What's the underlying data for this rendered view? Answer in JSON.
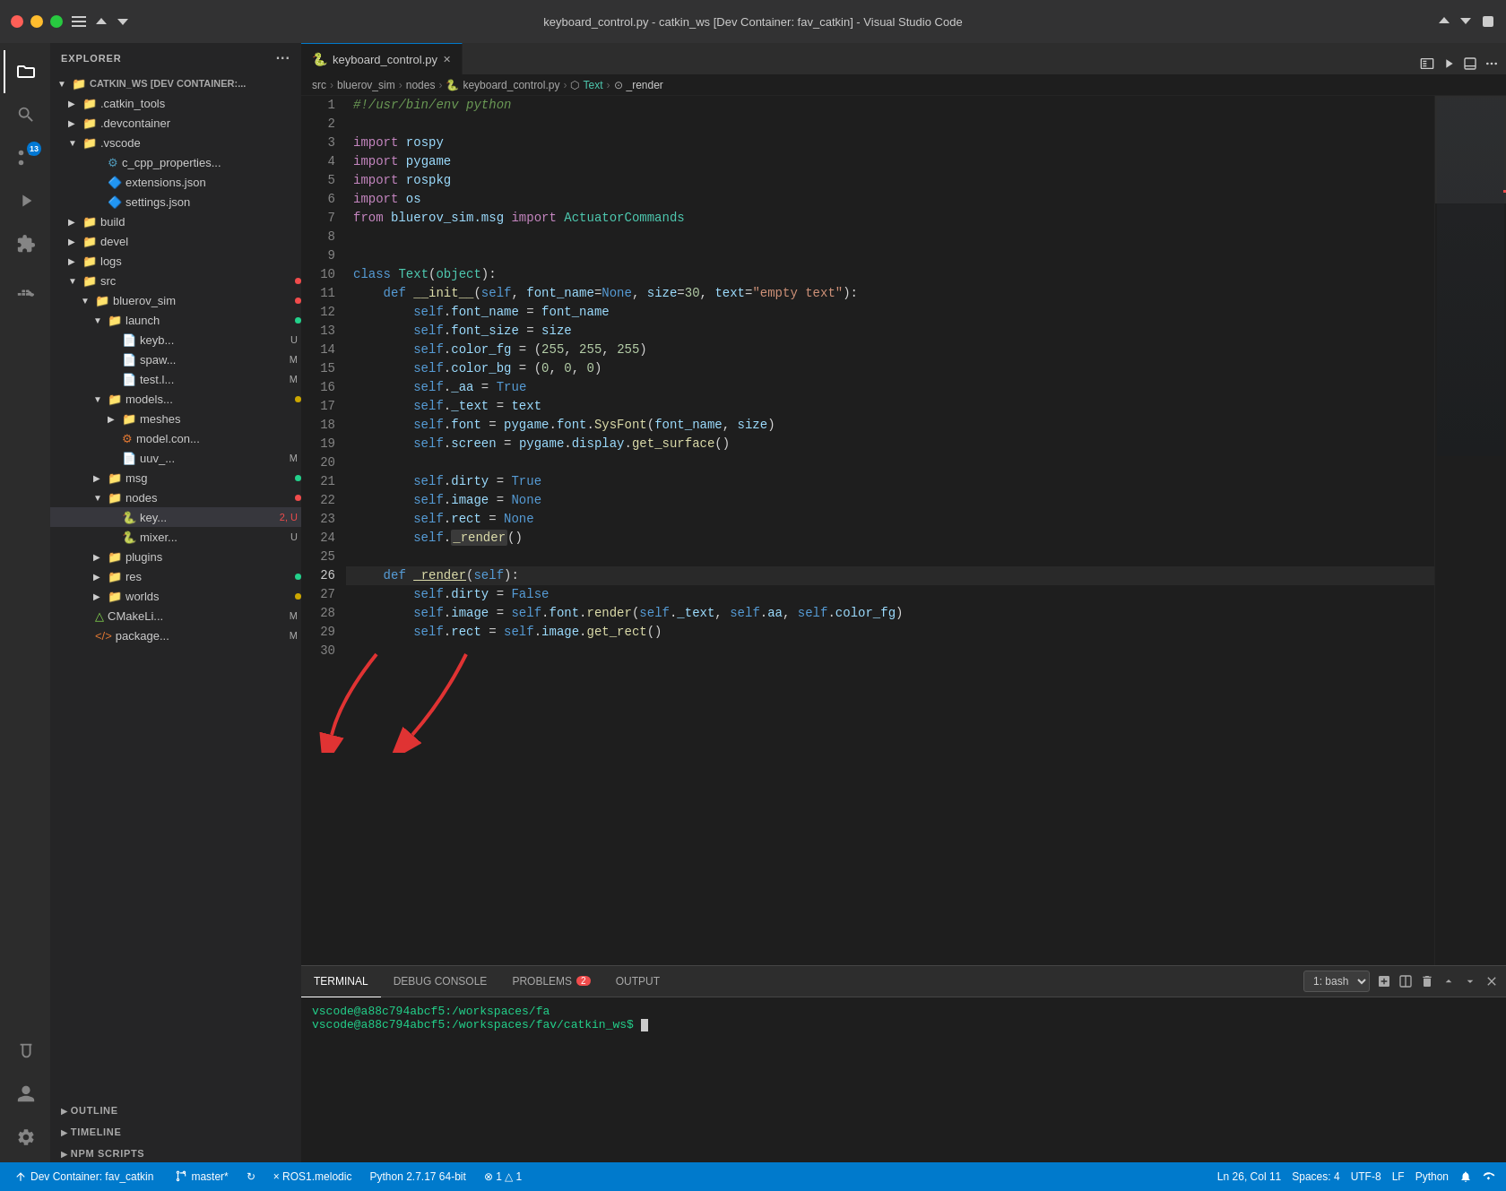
{
  "window": {
    "title": "keyboard_control.py - catkin_ws [Dev Container: fav_catkin] - Visual Studio Code"
  },
  "titleBar": {
    "close_label": "×",
    "min_label": "–",
    "max_label": "□"
  },
  "activityBar": {
    "icons": [
      {
        "name": "files-icon",
        "symbol": "⬜",
        "active": true,
        "badge": null
      },
      {
        "name": "search-icon",
        "symbol": "🔍",
        "active": false,
        "badge": null
      },
      {
        "name": "source-control-icon",
        "symbol": "⎇",
        "active": false,
        "badge": "13"
      },
      {
        "name": "run-icon",
        "symbol": "▷",
        "active": false,
        "badge": null
      },
      {
        "name": "extensions-icon",
        "symbol": "⊞",
        "active": false,
        "badge": null
      },
      {
        "name": "docker-icon",
        "symbol": "🐳",
        "active": false,
        "badge": null
      }
    ],
    "bottom": [
      {
        "name": "test-icon",
        "symbol": "🧪"
      },
      {
        "name": "account-icon",
        "symbol": "👤"
      },
      {
        "name": "settings-icon",
        "symbol": "⚙"
      }
    ]
  },
  "sidebar": {
    "title": "EXPLORER",
    "workspace": "CATKIN_WS [DEV CONTAINER:...",
    "tree": [
      {
        "level": 1,
        "label": ".catkin_tools",
        "type": "folder",
        "collapsed": true,
        "badge": null
      },
      {
        "level": 1,
        "label": ".devcontainer",
        "type": "folder",
        "collapsed": true,
        "badge": null
      },
      {
        "level": 1,
        "label": ".vscode",
        "type": "folder",
        "collapsed": false,
        "badge": null
      },
      {
        "level": 2,
        "label": "c_cpp_properties...",
        "type": "cpp",
        "badge": null
      },
      {
        "level": 2,
        "label": "extensions.json",
        "type": "json",
        "badge": null
      },
      {
        "level": 2,
        "label": "settings.json",
        "type": "json",
        "badge": null
      },
      {
        "level": 1,
        "label": "build",
        "type": "folder",
        "collapsed": true,
        "badge": null
      },
      {
        "level": 1,
        "label": "devel",
        "type": "folder",
        "collapsed": true,
        "badge": null
      },
      {
        "level": 1,
        "label": "logs",
        "type": "folder",
        "collapsed": true,
        "badge": null
      },
      {
        "level": 1,
        "label": "src",
        "type": "folder",
        "collapsed": false,
        "badge_color": "red"
      },
      {
        "level": 2,
        "label": "bluerov_sim",
        "type": "folder",
        "collapsed": false,
        "badge_color": "red"
      },
      {
        "level": 3,
        "label": "launch",
        "type": "folder",
        "collapsed": false,
        "badge_color": "green"
      },
      {
        "level": 4,
        "label": "keyb...",
        "type": "file",
        "badge": "U"
      },
      {
        "level": 4,
        "label": "spaw...",
        "type": "file",
        "badge": "M"
      },
      {
        "level": 4,
        "label": "test.l...",
        "type": "file",
        "badge": "M"
      },
      {
        "level": 3,
        "label": "models...",
        "type": "folder",
        "collapsed": false,
        "badge_color": "orange"
      },
      {
        "level": 4,
        "label": "meshes",
        "type": "folder",
        "collapsed": true,
        "badge": null
      },
      {
        "level": 4,
        "label": "model.con...",
        "type": "file",
        "badge": null
      },
      {
        "level": 4,
        "label": "uuv_...",
        "type": "file",
        "badge": "M"
      },
      {
        "level": 3,
        "label": "msg",
        "type": "folder",
        "collapsed": true,
        "badge_color": "green"
      },
      {
        "level": 3,
        "label": "nodes",
        "type": "folder",
        "collapsed": false,
        "badge_color": "red"
      },
      {
        "level": 4,
        "label": "key...",
        "type": "python",
        "badge": "2, U",
        "active": true
      },
      {
        "level": 4,
        "label": "mixer...",
        "type": "python",
        "badge": "U"
      },
      {
        "level": 3,
        "label": "plugins",
        "type": "folder",
        "collapsed": true,
        "badge": null
      },
      {
        "level": 3,
        "label": "res",
        "type": "folder",
        "collapsed": true,
        "badge_color": "green"
      },
      {
        "level": 3,
        "label": "worlds",
        "type": "folder",
        "collapsed": true,
        "badge_color": "orange"
      },
      {
        "level": 2,
        "label": "CMakeLi...",
        "type": "cmake",
        "badge": "M"
      },
      {
        "level": 2,
        "label": "package...",
        "type": "xml",
        "badge": "M"
      }
    ],
    "sections": [
      "OUTLINE",
      "TIMELINE",
      "NPM SCRIPTS"
    ]
  },
  "editor": {
    "tab": {
      "filename": "keyboard_control.py",
      "icon": "🐍",
      "modified": false
    },
    "breadcrumb": [
      "src",
      "bluerov_sim",
      "nodes",
      "keyboard_control.py",
      "Text",
      "_render"
    ],
    "lines": [
      {
        "n": 1,
        "code": "#!/usr/bin/env python",
        "type": "comment"
      },
      {
        "n": 2,
        "code": ""
      },
      {
        "n": 3,
        "code": "import rospy"
      },
      {
        "n": 4,
        "code": "import pygame"
      },
      {
        "n": 5,
        "code": "import rospkg"
      },
      {
        "n": 6,
        "code": "import os"
      },
      {
        "n": 7,
        "code": "from bluerov_sim.msg import ActuatorCommands"
      },
      {
        "n": 8,
        "code": ""
      },
      {
        "n": 9,
        "code": ""
      },
      {
        "n": 10,
        "code": "class Text(object):"
      },
      {
        "n": 11,
        "code": "    def __init__(self, font_name=None, size=30, text=\"empty text\"):"
      },
      {
        "n": 12,
        "code": "        self.font_name = font_name"
      },
      {
        "n": 13,
        "code": "        self.font_size = size"
      },
      {
        "n": 14,
        "code": "        self.color_fg = (255, 255, 255)"
      },
      {
        "n": 15,
        "code": "        self.color_bg = (0, 0, 0)"
      },
      {
        "n": 16,
        "code": "        self._aa = True"
      },
      {
        "n": 17,
        "code": "        self._text = text"
      },
      {
        "n": 18,
        "code": "        self.font = pygame.font.SysFont(font_name, size)"
      },
      {
        "n": 19,
        "code": "        self.screen = pygame.display.get_surface()"
      },
      {
        "n": 20,
        "code": ""
      },
      {
        "n": 21,
        "code": "        self.dirty = True"
      },
      {
        "n": 22,
        "code": "        self.image = None"
      },
      {
        "n": 23,
        "code": "        self.rect = None"
      },
      {
        "n": 24,
        "code": "        self._render()"
      },
      {
        "n": 25,
        "code": ""
      },
      {
        "n": 26,
        "code": "    def _render(self):"
      },
      {
        "n": 27,
        "code": "        self.dirty = False"
      },
      {
        "n": 28,
        "code": "        self.image = self.font.render(self._text, self.aa, self.color_fg)"
      },
      {
        "n": 29,
        "code": "        self.rect = self.image.get_rect()"
      },
      {
        "n": 30,
        "code": ""
      }
    ]
  },
  "terminal": {
    "tabs": [
      "TERMINAL",
      "DEBUG CONSOLE",
      "PROBLEMS",
      "OUTPUT"
    ],
    "problems_count": "2",
    "bash_label": "1: bash",
    "line1": "vscode@a88c794abcf5:/workspaces/fa",
    "line2": "vscode@a88c794abcf5:/workspaces/fav/catkin_ws$ "
  },
  "statusBar": {
    "dev_container": "Dev Container: fav_catkin",
    "branch": "master*",
    "sync": "↻",
    "ros": "× ROS1.melodic",
    "python": "Python 2.7.17 64-bit",
    "errors": "⊗ 1 △ 1",
    "position": "Ln 26, Col 11",
    "spaces": "Spaces: 4",
    "encoding": "UTF-8",
    "eol": "LF",
    "language": "Python"
  }
}
